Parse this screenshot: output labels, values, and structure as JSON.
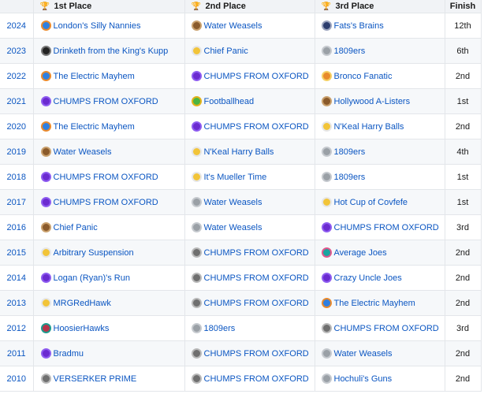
{
  "headers": {
    "place1": "1st Place",
    "place2": "2nd Place",
    "place3": "3rd Place",
    "finish": "Finish"
  },
  "trophy_icons": {
    "place1": "gold-trophy-icon",
    "place2": "silver-trophy-icon",
    "place3": "bronze-trophy-icon"
  },
  "rows": [
    {
      "year": "2024",
      "first": {
        "name": "London's Silly Nannies",
        "logo": "blue"
      },
      "second": {
        "name": "Water Weasels",
        "logo": "brown"
      },
      "third": {
        "name": "Fats's Brains",
        "logo": "navy"
      },
      "finish": "12th"
    },
    {
      "year": "2023",
      "first": {
        "name": "Drinketh from the King's Kupp",
        "logo": "black"
      },
      "second": {
        "name": "Chief Panic",
        "logo": "yellow"
      },
      "third": {
        "name": "1809ers",
        "logo": "gray"
      },
      "finish": "6th"
    },
    {
      "year": "2022",
      "first": {
        "name": "The Electric Mayhem",
        "logo": "blue"
      },
      "second": {
        "name": "CHUMPS FROM OXFORD",
        "logo": "purple"
      },
      "third": {
        "name": "Bronco Fanatic",
        "logo": "orange"
      },
      "finish": "2nd"
    },
    {
      "year": "2021",
      "first": {
        "name": "CHUMPS FROM OXFORD",
        "logo": "purple"
      },
      "second": {
        "name": "Footballhead",
        "logo": "green"
      },
      "third": {
        "name": "Hollywood A-Listers",
        "logo": "brown"
      },
      "finish": "1st"
    },
    {
      "year": "2020",
      "first": {
        "name": "The Electric Mayhem",
        "logo": "blue"
      },
      "second": {
        "name": "CHUMPS FROM OXFORD",
        "logo": "purple"
      },
      "third": {
        "name": "N'Keal Harry Balls",
        "logo": "yellow"
      },
      "finish": "2nd"
    },
    {
      "year": "2019",
      "first": {
        "name": "Water Weasels",
        "logo": "brown"
      },
      "second": {
        "name": "N'Keal Harry Balls",
        "logo": "yellow"
      },
      "third": {
        "name": "1809ers",
        "logo": "gray"
      },
      "finish": "4th"
    },
    {
      "year": "2018",
      "first": {
        "name": "CHUMPS FROM OXFORD",
        "logo": "purple"
      },
      "second": {
        "name": "It's Mueller Time",
        "logo": "yellow"
      },
      "third": {
        "name": "1809ers",
        "logo": "gray"
      },
      "finish": "1st"
    },
    {
      "year": "2017",
      "first": {
        "name": "CHUMPS FROM OXFORD",
        "logo": "purple"
      },
      "second": {
        "name": "Water Weasels",
        "logo": "gray"
      },
      "third": {
        "name": "Hot Cup of Covfefe",
        "logo": "yellow"
      },
      "finish": "1st"
    },
    {
      "year": "2016",
      "first": {
        "name": "Chief Panic",
        "logo": "brown"
      },
      "second": {
        "name": "Water Weasels",
        "logo": "gray"
      },
      "third": {
        "name": "CHUMPS FROM OXFORD",
        "logo": "purple"
      },
      "finish": "3rd"
    },
    {
      "year": "2015",
      "first": {
        "name": "Arbitrary Suspension",
        "logo": "yellow"
      },
      "second": {
        "name": "CHUMPS FROM OXFORD",
        "logo": "person"
      },
      "third": {
        "name": "Average Joes",
        "logo": "teal"
      },
      "finish": "2nd"
    },
    {
      "year": "2014",
      "first": {
        "name": "Logan (Ryan)'s Run",
        "logo": "purple"
      },
      "second": {
        "name": "CHUMPS FROM OXFORD",
        "logo": "person"
      },
      "third": {
        "name": "Crazy Uncle Joes",
        "logo": "purple"
      },
      "finish": "2nd"
    },
    {
      "year": "2013",
      "first": {
        "name": "MRGRedHawk",
        "logo": "yellow"
      },
      "second": {
        "name": "CHUMPS FROM OXFORD",
        "logo": "person"
      },
      "third": {
        "name": "The Electric Mayhem",
        "logo": "blue"
      },
      "finish": "2nd"
    },
    {
      "year": "2012",
      "first": {
        "name": "HoosierHawks",
        "logo": "red"
      },
      "second": {
        "name": "1809ers",
        "logo": "gray"
      },
      "third": {
        "name": "CHUMPS FROM OXFORD",
        "logo": "person"
      },
      "finish": "3rd"
    },
    {
      "year": "2011",
      "first": {
        "name": "Bradmu",
        "logo": "purple"
      },
      "second": {
        "name": "CHUMPS FROM OXFORD",
        "logo": "person"
      },
      "third": {
        "name": "Water Weasels",
        "logo": "gray"
      },
      "finish": "2nd"
    },
    {
      "year": "2010",
      "first": {
        "name": "VERSERKER PRIME",
        "logo": "person"
      },
      "second": {
        "name": "CHUMPS FROM OXFORD",
        "logo": "person"
      },
      "third": {
        "name": "Hochuli's Guns",
        "logo": "gray"
      },
      "finish": "2nd"
    }
  ]
}
